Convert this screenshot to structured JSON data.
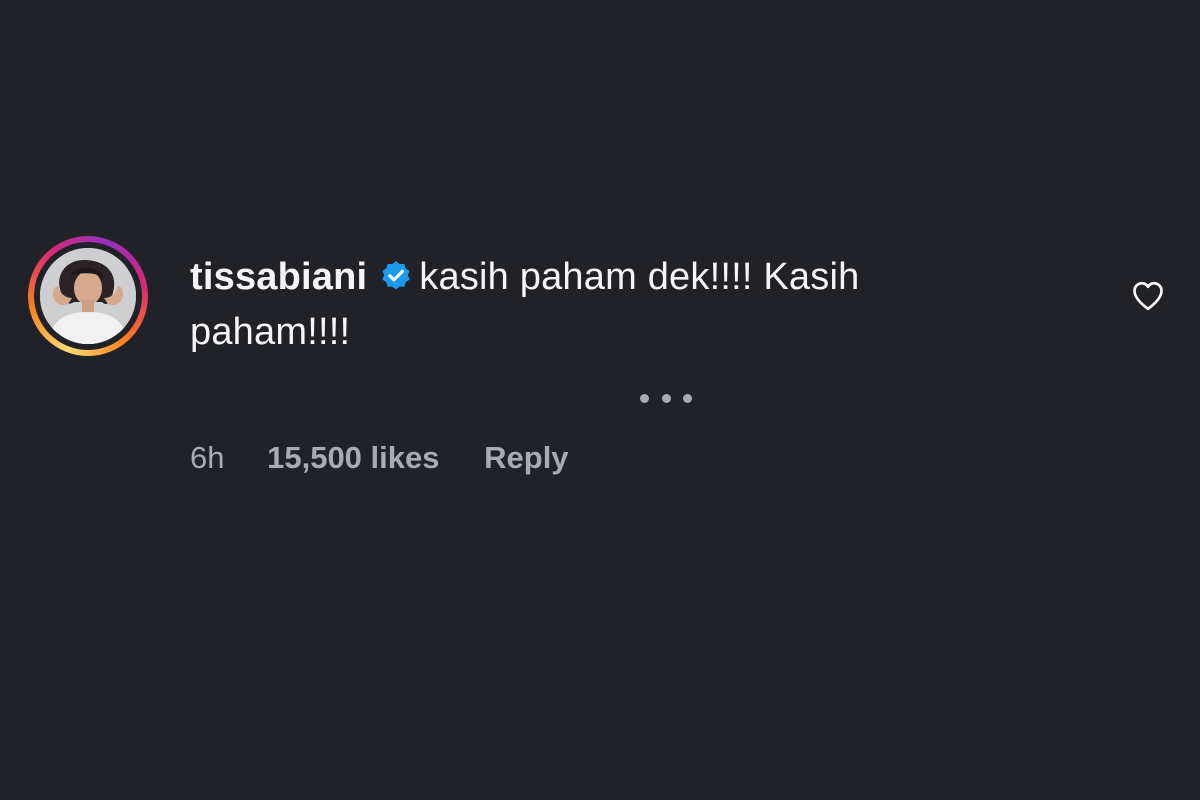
{
  "comment": {
    "username": "tissabiani",
    "verified": true,
    "text": "kasih paham dek!!!! Kasih paham!!!!",
    "time": "6h",
    "likes": "15,500 likes",
    "reply_label": "Reply"
  },
  "icons": {
    "verified": "verified-badge-icon",
    "like": "heart-icon",
    "more": "more-options-icon"
  },
  "colors": {
    "background": "#212227",
    "text": "#f5f5f5",
    "muted": "#a8abb3",
    "verified": "#1d9bf0"
  }
}
